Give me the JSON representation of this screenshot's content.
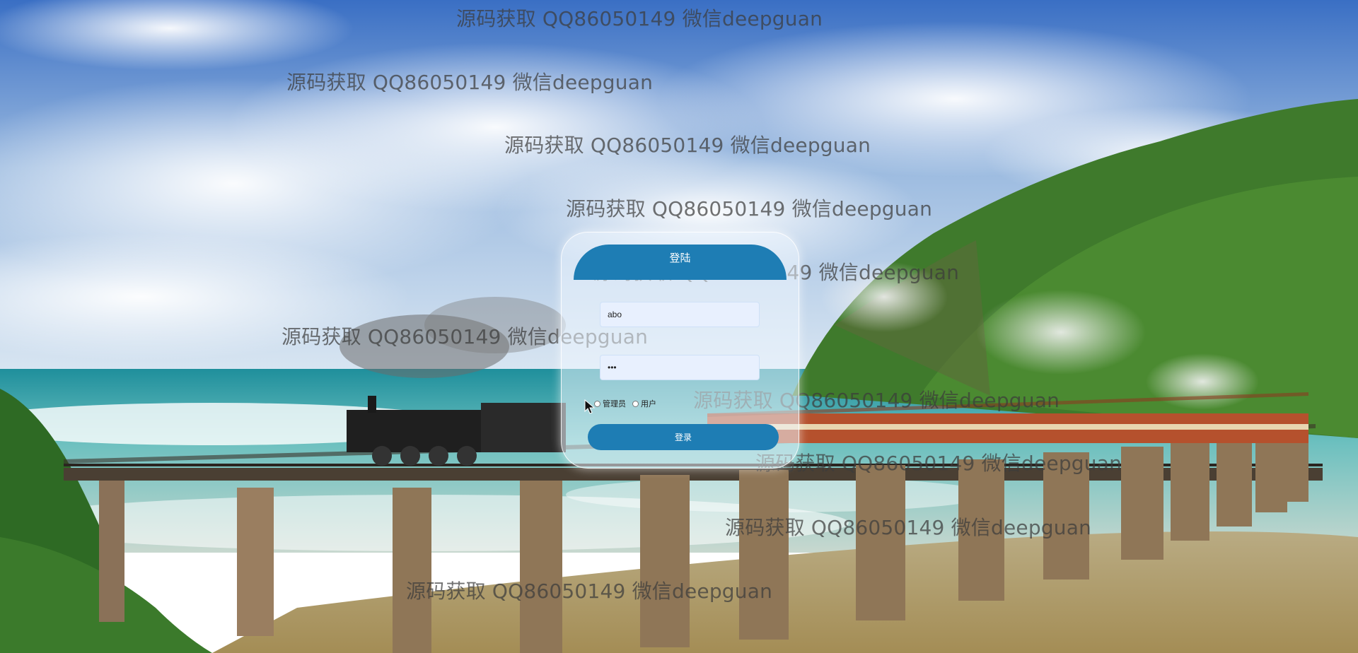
{
  "watermark_text": "源码获取 QQ86050149 微信deepguan",
  "login": {
    "title": "登陆",
    "username_value": "abo",
    "password_value": "•••",
    "roles": [
      {
        "label": "管理员",
        "selected": false
      },
      {
        "label": "用户",
        "selected": false
      }
    ],
    "submit_label": "登录"
  },
  "colors": {
    "accent": "#1e7db4",
    "sky": "#3f78c8",
    "sea": "#3aa6a8",
    "hill": "#3f7a2c",
    "train": "#b5512d"
  }
}
